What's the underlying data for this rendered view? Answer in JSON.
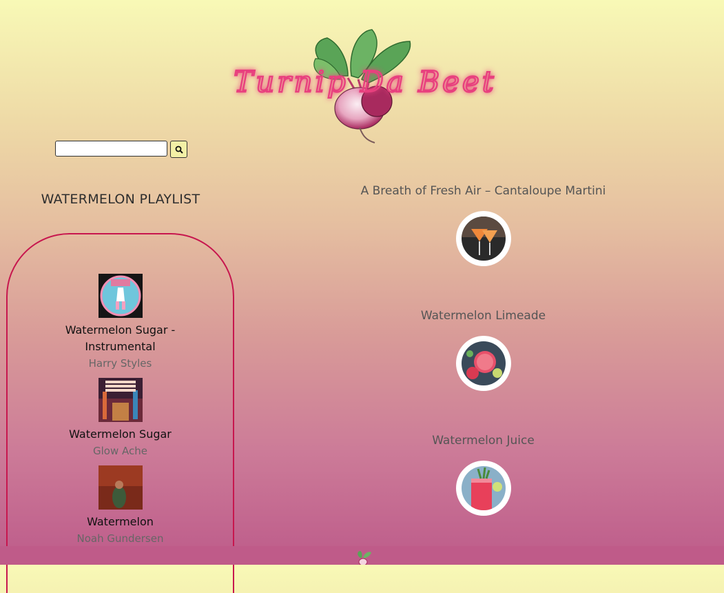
{
  "header": {
    "site_name": "Turnip Da Beet"
  },
  "search": {
    "placeholder": "",
    "value": "",
    "button_icon": "search-icon"
  },
  "playlist": {
    "title": "WATERMELON PLAYLIST",
    "tracks": [
      {
        "name": "Watermelon Sugar - Instrumental",
        "artist": "Harry Styles"
      },
      {
        "name": "Watermelon Sugar",
        "artist": "Glow Ache"
      },
      {
        "name": "Watermelon",
        "artist": "Noah Gundersen"
      }
    ]
  },
  "recipes": [
    {
      "title": "A Breath of Fresh Air – Cantaloupe Martini"
    },
    {
      "title": "Watermelon Limeade"
    },
    {
      "title": "Watermelon Juice"
    }
  ],
  "colors": {
    "logo_pink": "#e8407e",
    "playlist_border": "#c7164e",
    "search_button": "#f3f0a6"
  }
}
